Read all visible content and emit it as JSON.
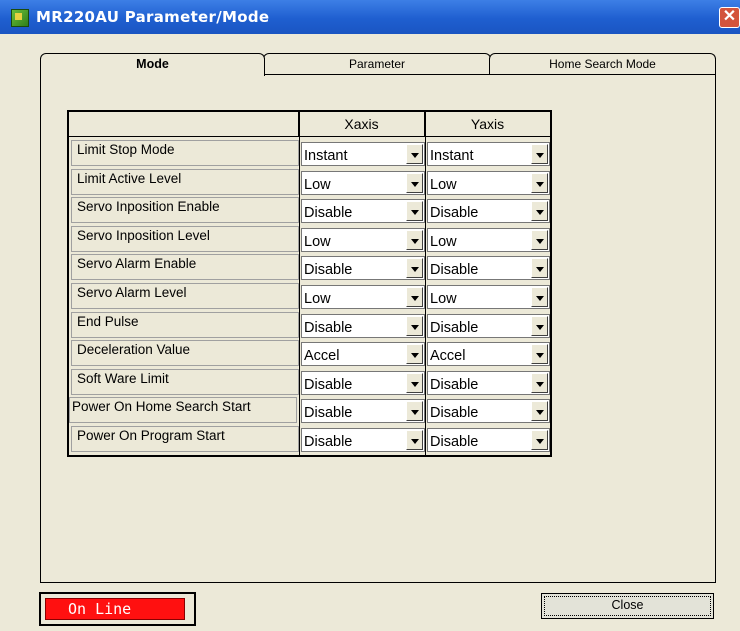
{
  "window": {
    "title": "MR220AU Parameter/Mode",
    "close_glyph": "✕"
  },
  "tabs": [
    {
      "label": "Mode",
      "active": true
    },
    {
      "label": "Parameter",
      "active": false
    },
    {
      "label": "Home Search Mode",
      "active": false
    }
  ],
  "grid": {
    "columns": [
      "Xaxis",
      "Yaxis"
    ],
    "rows": [
      {
        "label": "Limit Stop Mode",
        "x": "Instant",
        "y": "Instant"
      },
      {
        "label": "Limit Active Level",
        "x": "Low",
        "y": "Low"
      },
      {
        "label": "Servo Inposition Enable",
        "x": "Disable",
        "y": "Disable"
      },
      {
        "label": "Servo Inposition Level",
        "x": "Low",
        "y": "Low"
      },
      {
        "label": "Servo Alarm Enable",
        "x": "Disable",
        "y": "Disable"
      },
      {
        "label": "Servo Alarm Level",
        "x": "Low",
        "y": "Low"
      },
      {
        "label": "End Pulse",
        "x": "Disable",
        "y": "Disable"
      },
      {
        "label": "Deceleration Value",
        "x": "Accel",
        "y": "Accel"
      },
      {
        "label": "Soft Ware Limit",
        "x": "Disable",
        "y": "Disable"
      },
      {
        "label": "Power On Home Search Start",
        "x": "Disable",
        "y": "Disable"
      },
      {
        "label": "Power On Program Start",
        "x": "Disable",
        "y": "Disable"
      }
    ]
  },
  "status": {
    "label": "On Line",
    "color": "#ff1010"
  },
  "close_button": {
    "label": "Close"
  },
  "colors": {
    "titlebar": "#1f5fd0",
    "window_bg": "#ece9d8"
  }
}
